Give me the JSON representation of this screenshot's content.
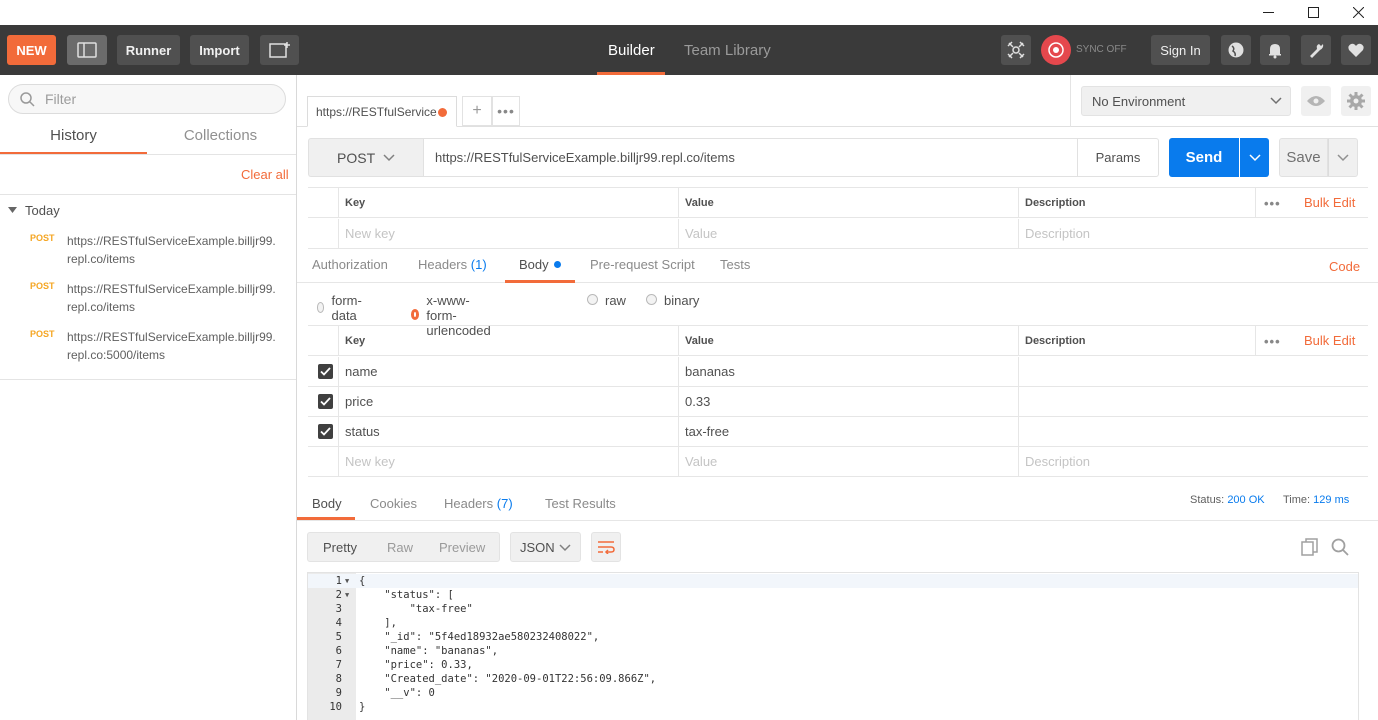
{
  "window": {
    "minimize_icon": "minimize-icon",
    "maximize_icon": "maximize-icon",
    "close_icon": "close-icon"
  },
  "header": {
    "new_label": "NEW",
    "runner_label": "Runner",
    "import_label": "Import",
    "tabs": [
      {
        "label": "Builder",
        "active": true
      },
      {
        "label": "Team Library",
        "active": false
      }
    ],
    "sync_label": "SYNC OFF",
    "signin_label": "Sign In"
  },
  "sidebar": {
    "filter_placeholder": "Filter",
    "tabs": [
      {
        "label": "History",
        "active": true
      },
      {
        "label": "Collections",
        "active": false
      }
    ],
    "clear_all": "Clear all",
    "group_label": "Today",
    "history": [
      {
        "method": "POST",
        "url": "https://RESTfulServiceExample.billjr99.repl.co/items"
      },
      {
        "method": "POST",
        "url": "https://RESTfulServiceExample.billjr99.repl.co/items"
      },
      {
        "method": "POST",
        "url": "https://RESTfulServiceExample.billjr99.repl.co:5000/items"
      }
    ]
  },
  "request_tab": {
    "label": "https://RESTfulService",
    "add": "+",
    "more": "•••"
  },
  "environment": {
    "selected": "No Environment"
  },
  "request": {
    "method": "POST",
    "url": "https://RESTfulServiceExample.billjr99.repl.co/items",
    "params_label": "Params",
    "send_label": "Send",
    "save_label": "Save"
  },
  "params_table": {
    "headers": {
      "key": "Key",
      "value": "Value",
      "description": "Description"
    },
    "bulk_edit": "Bulk Edit",
    "placeholder": {
      "key": "New key",
      "value": "Value",
      "description": "Description"
    }
  },
  "subtabs": {
    "authorization": "Authorization",
    "headers": "Headers",
    "headers_count": "(1)",
    "body": "Body",
    "prerequest": "Pre-request Script",
    "tests": "Tests",
    "code": "Code"
  },
  "body_modes": [
    {
      "label": "form-data",
      "selected": false
    },
    {
      "label": "x-www-form-urlencoded",
      "selected": true
    },
    {
      "label": "raw",
      "selected": false
    },
    {
      "label": "binary",
      "selected": false
    }
  ],
  "body_table": {
    "headers": {
      "key": "Key",
      "value": "Value",
      "description": "Description"
    },
    "bulk_edit": "Bulk Edit",
    "rows": [
      {
        "checked": true,
        "key": "name",
        "value": "bananas"
      },
      {
        "checked": true,
        "key": "price",
        "value": "0.33"
      },
      {
        "checked": true,
        "key": "status",
        "value": "tax-free"
      }
    ],
    "placeholder": {
      "key": "New key",
      "value": "Value",
      "description": "Description"
    }
  },
  "response": {
    "tabs": {
      "body": "Body",
      "cookies": "Cookies",
      "headers": "Headers",
      "headers_count": "(7)",
      "test_results": "Test Results"
    },
    "status_label": "Status:",
    "status_value": "200 OK",
    "time_label": "Time:",
    "time_value": "129 ms",
    "views": [
      "Pretty",
      "Raw",
      "Preview"
    ],
    "format": "JSON"
  },
  "response_code": [
    "{",
    "    \"status\": [",
    "        \"tax-free\"",
    "    ],",
    "    \"_id\": \"5f4ed18932ae580232408022\",",
    "    \"name\": \"bananas\",",
    "    \"price\": 0.33,",
    "    \"Created_date\": \"2020-09-01T22:56:09.866Z\",",
    "    \"__v\": 0",
    "}"
  ],
  "colors": {
    "accent": "#f26b3a",
    "send_blue": "#097bed",
    "header_bg": "#3a3a3a"
  }
}
